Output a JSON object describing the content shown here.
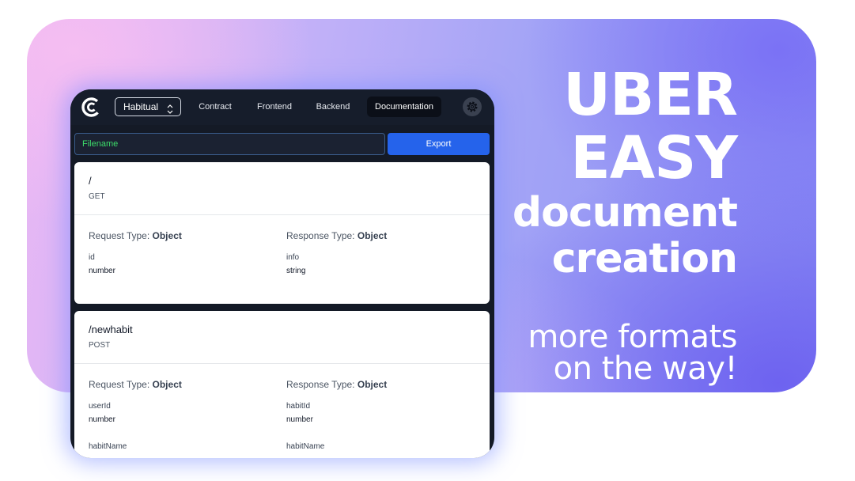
{
  "headline": {
    "line1": "UBER",
    "line2": "EASY",
    "line3": "document",
    "line4": "creation"
  },
  "tagline": {
    "line1": "more formats",
    "line2": "on the way!"
  },
  "app": {
    "project_select": "Habitual",
    "tabs": [
      {
        "label": "Contract",
        "active": false
      },
      {
        "label": "Frontend",
        "active": false
      },
      {
        "label": "Backend",
        "active": false
      },
      {
        "label": "Documentation",
        "active": true
      }
    ],
    "filename_placeholder": "Filename",
    "export_label": "Export",
    "accent_color": "#2563eb",
    "endpoints": [
      {
        "path": "/",
        "method": "GET",
        "request_label": "Request Type:",
        "request_type": "Object",
        "response_label": "Response Type:",
        "response_type": "Object",
        "request_fields": [
          {
            "name": "id",
            "type": "number"
          }
        ],
        "response_fields": [
          {
            "name": "info",
            "type": "string"
          }
        ]
      },
      {
        "path": "/newhabit",
        "method": "POST",
        "request_label": "Request Type:",
        "request_type": "Object",
        "response_label": "Response Type:",
        "response_type": "Object",
        "request_fields": [
          {
            "name": "userId",
            "type": "number"
          },
          {
            "name": "habitName",
            "type": ""
          }
        ],
        "response_fields": [
          {
            "name": "habitId",
            "type": "number"
          },
          {
            "name": "habitName",
            "type": ""
          }
        ]
      }
    ]
  }
}
